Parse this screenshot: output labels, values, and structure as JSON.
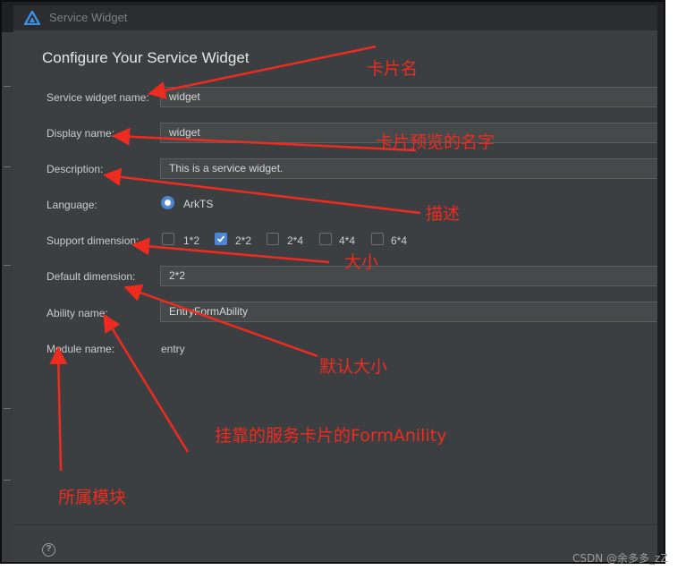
{
  "window": {
    "title": "Service Widget",
    "heading": "Configure Your Service Widget"
  },
  "form": {
    "service_widget_name": {
      "label": "Service widget name:",
      "value": "widget"
    },
    "display_name": {
      "label": "Display name:",
      "value": "widget"
    },
    "description": {
      "label": "Description:",
      "value": "This is a service widget."
    },
    "language": {
      "label": "Language:",
      "selected": "ArkTS"
    },
    "support_dimension": {
      "label": "Support dimension:",
      "options": [
        {
          "label": "1*2",
          "checked": false
        },
        {
          "label": "2*2",
          "checked": true
        },
        {
          "label": "2*4",
          "checked": false
        },
        {
          "label": "4*4",
          "checked": false
        },
        {
          "label": "6*4",
          "checked": false
        }
      ]
    },
    "default_dimension": {
      "label": "Default dimension:",
      "value": "2*2"
    },
    "ability_name": {
      "label": "Ability name:",
      "value": "EntryFormAbility"
    },
    "module_name": {
      "label": "Module name:",
      "value": "entry"
    }
  },
  "annotations": {
    "card_name": "卡片名",
    "preview_name": "卡片预览的名字",
    "description": "描述",
    "size": "大小",
    "default_size": "默认大小",
    "form_ability": "挂靠的服务卡片的FormAnility",
    "module": "所属模块"
  },
  "watermark": "CSDN @余多多_zZ",
  "colors": {
    "annotation_red": "#ee2b1f",
    "accent_blue": "#4c84d6",
    "dialog_bg": "#3c3f41",
    "field_bg": "#45494a"
  },
  "icons": {
    "app": "harmony-triangle-icon",
    "help": "question-circle-icon",
    "check": "checkmark-icon"
  }
}
